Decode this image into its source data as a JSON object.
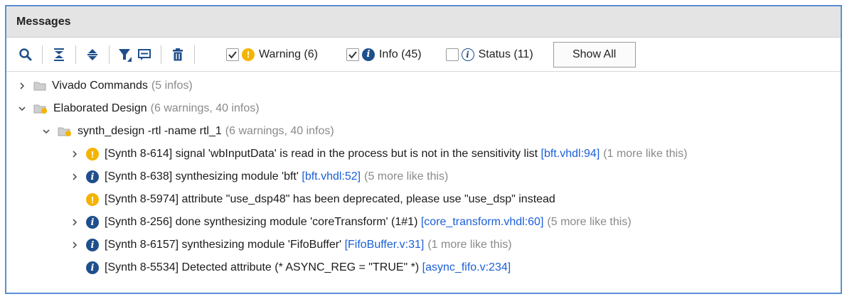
{
  "panel": {
    "title": "Messages"
  },
  "toolbar": {
    "warning": {
      "label": "Warning (6)",
      "checked": true
    },
    "info": {
      "label": "Info (45)",
      "checked": true
    },
    "status": {
      "label": "Status (11)",
      "checked": false
    },
    "show_all": "Show All"
  },
  "tree": [
    {
      "label": "Vivado Commands",
      "count": "(5 infos)"
    },
    {
      "label": "Elaborated Design",
      "count": "(6 warnings, 40 infos)"
    },
    {
      "label": "synth_design -rtl -name rtl_1",
      "count": "(6 warnings, 40 infos)"
    }
  ],
  "messages": [
    {
      "type": "warning",
      "text": "[Synth 8-614] signal 'wbInputData' is read in the process but is not in the sensitivity list",
      "link": "[bft.vhdl:94]",
      "more": "(1 more like this)"
    },
    {
      "type": "info",
      "text": "[Synth 8-638] synthesizing module 'bft'",
      "link": "[bft.vhdl:52]",
      "more": "(5 more like this)"
    },
    {
      "type": "warning",
      "text": "[Synth 8-5974] attribute \"use_dsp48\" has been deprecated, please use \"use_dsp\" instead",
      "link": "",
      "more": ""
    },
    {
      "type": "info",
      "text": "[Synth 8-256] done synthesizing module 'coreTransform' (1#1)",
      "link": "[core_transform.vhdl:60]",
      "more": "(5 more like this)"
    },
    {
      "type": "info",
      "text": "[Synth 8-6157] synthesizing module 'FifoBuffer'",
      "link": "[FifoBuffer.v:31]",
      "more": "(1 more like this)"
    },
    {
      "type": "info",
      "text": "[Synth 8-5534] Detected attribute (* ASYNC_REG = \"TRUE\" *)",
      "link": "[async_fifo.v:234]",
      "more": ""
    }
  ],
  "colors": {
    "accent_border": "#5b8ed6",
    "link": "#1a5fd8",
    "warning": "#f4b400",
    "info": "#1e4f8c",
    "muted": "#8a8a8a"
  }
}
